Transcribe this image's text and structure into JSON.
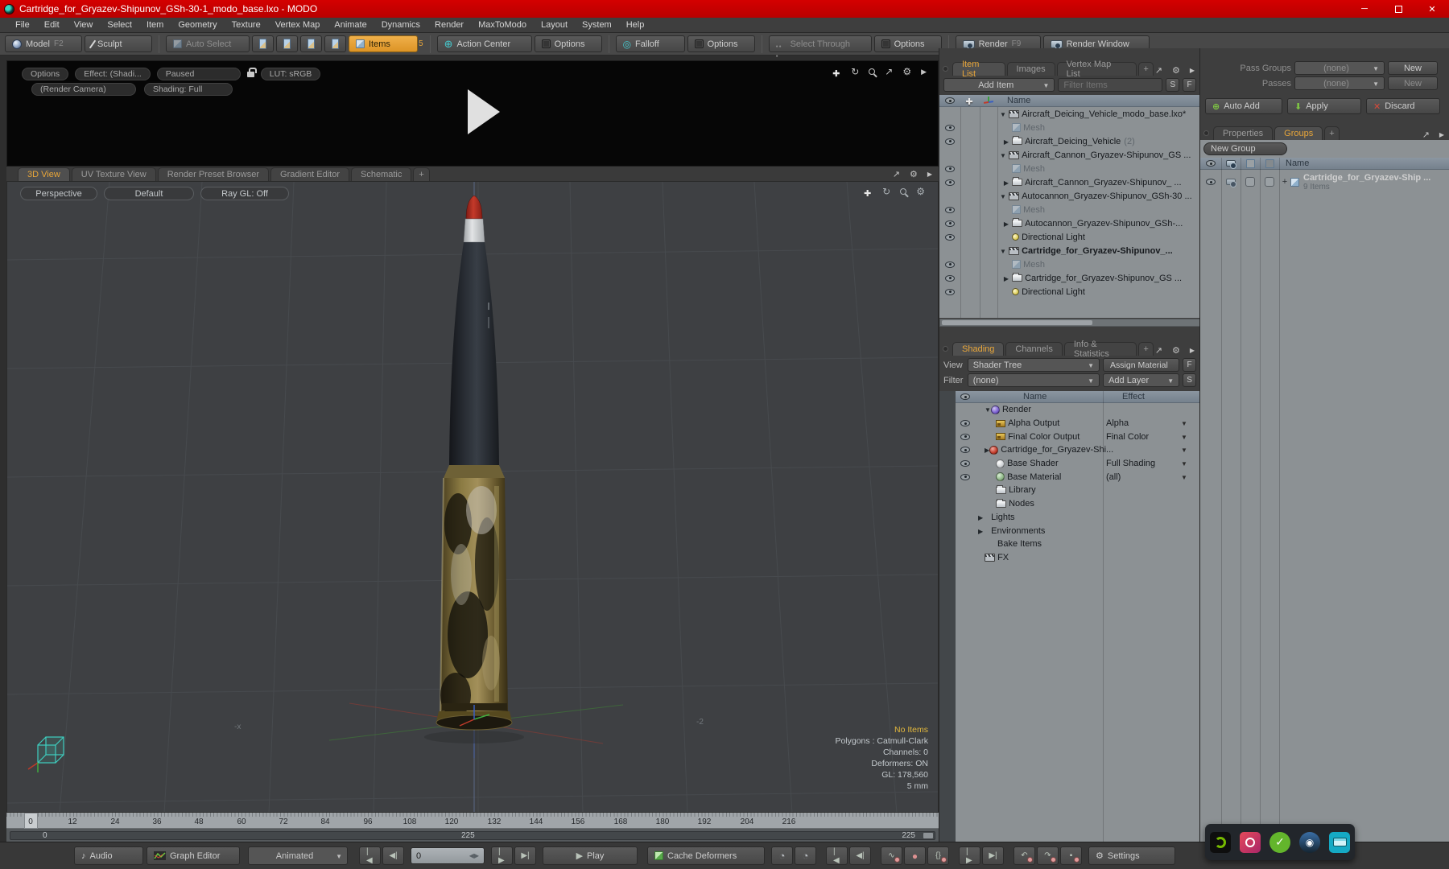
{
  "window": {
    "title": "Cartridge_for_Gryazev-Shipunov_GSh-30-1_modo_base.lxo - MODO"
  },
  "menu": {
    "items": [
      "File",
      "Edit",
      "View",
      "Select",
      "Item",
      "Geometry",
      "Texture",
      "Vertex Map",
      "Animate",
      "Dynamics",
      "Render",
      "MaxToModo",
      "Layout",
      "System",
      "Help"
    ]
  },
  "toolbar": {
    "model": "Model",
    "model_key": "F2",
    "sculpt": "Sculpt",
    "auto_select": "Auto Select",
    "items": "Items",
    "items_count": "5",
    "action_center": "Action Center",
    "options1": "Options",
    "falloff": "Falloff",
    "options2": "Options",
    "select_through": "Select Through",
    "options3": "Options",
    "render": "Render",
    "render_key": "F9",
    "render_window": "Render Window"
  },
  "preview": {
    "options": "Options",
    "effect": "Effect: (Shadi...",
    "paused": "Paused",
    "lut": "LUT: sRGB",
    "camera": "(Render Camera)",
    "shading": "Shading: Full"
  },
  "view_tabs": {
    "t0": "3D View",
    "t1": "UV Texture View",
    "t2": "Render Preset Browser",
    "t3": "Gradient Editor",
    "t4": "Schematic",
    "plus": "+"
  },
  "viewport": {
    "perspective": "Perspective",
    "default": "Default",
    "raygl": "Ray GL: Off",
    "no_items": "No Items",
    "stat1": "Polygons : Catmull-Clark",
    "stat2": "Channels: 0",
    "stat3": "Deformers: ON",
    "stat4": "GL: 178,560",
    "stat5": "5 mm",
    "axis_x": "-x",
    "axis_2": "-2"
  },
  "timeline": {
    "ticks": [
      "0",
      "12",
      "24",
      "36",
      "48",
      "60",
      "72",
      "84",
      "96",
      "108",
      "120",
      "132",
      "144",
      "156",
      "168",
      "180",
      "192",
      "204",
      "216"
    ],
    "range_start": "0",
    "range_mid": "225",
    "range_end": "225"
  },
  "transport": {
    "audio": "Audio",
    "graph": "Graph Editor",
    "mode": "Animated",
    "frame": "0",
    "play": "Play",
    "cache": "Cache Deformers",
    "settings": "Settings"
  },
  "item_list": {
    "tabs": {
      "t0": "Item List",
      "t1": "Images",
      "t2": "Vertex Map List",
      "plus": "+"
    },
    "add_item": "Add Item",
    "filter": "Filter Items",
    "s": "S",
    "f": "F",
    "name_col": "Name",
    "rows": [
      {
        "label": "Aircraft_Deicing_Vehicle_modo_base.lxo*"
      },
      {
        "label": "Mesh"
      },
      {
        "label": "Aircraft_Deicing_Vehicle",
        "suffix": "(2)"
      },
      {
        "label": "Aircraft_Cannon_Gryazev-Shipunov_GS ..."
      },
      {
        "label": "Mesh"
      },
      {
        "label": "Aircraft_Cannon_Gryazev-Shipunov_ ..."
      },
      {
        "label": "Autocannon_Gryazev-Shipunov_GSh-30 ..."
      },
      {
        "label": "Mesh"
      },
      {
        "label": "Autocannon_Gryazev-Shipunov_GSh-..."
      },
      {
        "label": "Directional Light"
      },
      {
        "label": "Cartridge_for_Gryazev-Shipunov_..."
      },
      {
        "label": "Mesh"
      },
      {
        "label": "Cartridge_for_Gryazev-Shipunov_GS ..."
      },
      {
        "label": "Directional Light"
      }
    ]
  },
  "shading": {
    "tabs": {
      "t0": "Shading",
      "t1": "Channels",
      "t2": "Info & Statistics",
      "plus": "+"
    },
    "view_label": "View",
    "view_value": "Shader Tree",
    "assign": "Assign Material",
    "f": "F",
    "filter_label": "Filter",
    "filter_value": "(none)",
    "add_layer": "Add Layer",
    "s": "S",
    "name_col": "Name",
    "effect_col": "Effect",
    "rows": [
      {
        "label": "Render",
        "effect": ""
      },
      {
        "label": "Alpha Output",
        "effect": "Alpha"
      },
      {
        "label": "Final Color Output",
        "effect": "Final Color"
      },
      {
        "label": "Cartridge_for_Gryazev-Shi...",
        "effect": ""
      },
      {
        "label": "Base Shader",
        "effect": "Full Shading"
      },
      {
        "label": "Base Material",
        "effect": "(all)"
      },
      {
        "label": "Library",
        "effect": ""
      },
      {
        "label": "Nodes",
        "effect": ""
      },
      {
        "label": "Lights",
        "effect": ""
      },
      {
        "label": "Environments",
        "effect": ""
      },
      {
        "label": "Bake Items",
        "effect": ""
      },
      {
        "label": "FX",
        "effect": ""
      }
    ]
  },
  "passes": {
    "pass_groups_label": "Pass Groups",
    "passes_label": "Passes",
    "pass_groups_value": "(none)",
    "passes_value": "(none)",
    "new1": "New",
    "new2": "New",
    "auto_add": "Auto Add",
    "apply": "Apply",
    "discard": "Discard"
  },
  "groups": {
    "tabs": {
      "t0": "Properties",
      "t1": "Groups",
      "plus": "+"
    },
    "new_group": "New Group",
    "name_col": "Name",
    "row_label": "Cartridge_for_Gryazev-Ship ...",
    "row_count": "9 Items"
  },
  "colors": {
    "accent_orange": "#e8a63a",
    "title_red": "#c00000",
    "brass": "#8a7a42",
    "tip_red": "#c03a2b"
  }
}
